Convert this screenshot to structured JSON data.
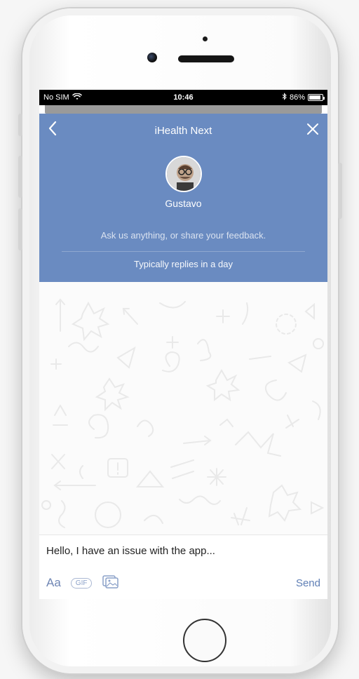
{
  "status": {
    "carrier": "No SIM",
    "time": "10:46",
    "battery": "86%"
  },
  "header": {
    "title": "iHealth Next",
    "back_icon": "chevron-left-icon",
    "close_icon": "close-icon",
    "name": "Gustavo",
    "subtitle": "Ask us anything, or share your feedback.",
    "reply_time": "Typically replies in a day",
    "accent": "#6a8bc1"
  },
  "composer": {
    "message": "Hello, I have an issue with the app...",
    "format_label": "Aa",
    "gif_label": "GIF",
    "image_icon": "image-icon",
    "send_label": "Send"
  }
}
